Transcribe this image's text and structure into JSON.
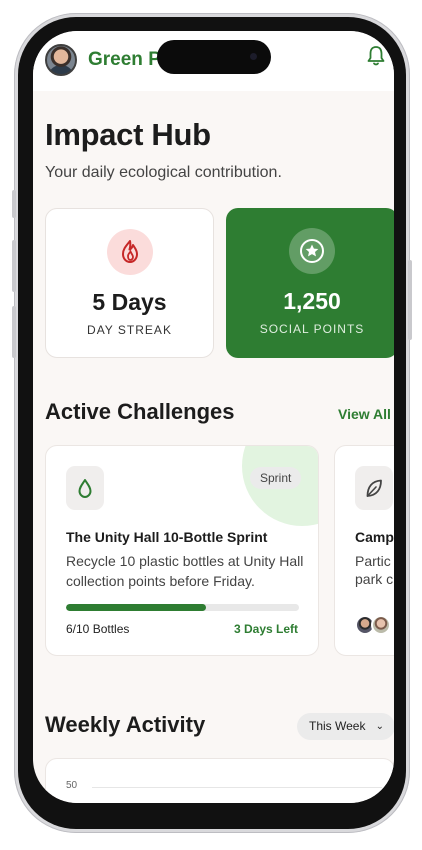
{
  "header": {
    "brand": "Green P"
  },
  "hero": {
    "title": "Impact Hub",
    "subtitle": "Your daily ecological contribution."
  },
  "stats": [
    {
      "value": "5 Days",
      "label": "DAY STREAK",
      "icon": "flame-icon"
    },
    {
      "value": "1,250",
      "label": "SOCIAL POINTS",
      "icon": "star-icon"
    }
  ],
  "challenges_section": {
    "title": "Active Challenges",
    "view_all": "View All"
  },
  "challenges": [
    {
      "badge": "Sprint",
      "title": "The Unity Hall 10-Bottle Sprint",
      "description": "Recycle 10 plastic bottles at Unity Hall collection points before Friday.",
      "progress_label": "6/10 Bottles",
      "progress": 0.6,
      "time_left": "3 Days Left",
      "icon": "water-drop-icon"
    },
    {
      "title": "Camp",
      "description_line1": "Partic",
      "description_line2": "park c",
      "icon": "leaf-icon"
    }
  ],
  "weekly": {
    "title": "Weekly Activity",
    "selector": "This Week",
    "y_tick": "50"
  },
  "colors": {
    "accent": "#2e7d32",
    "streak_bg": "#fbdcdb",
    "streak_icon": "#c62828"
  }
}
